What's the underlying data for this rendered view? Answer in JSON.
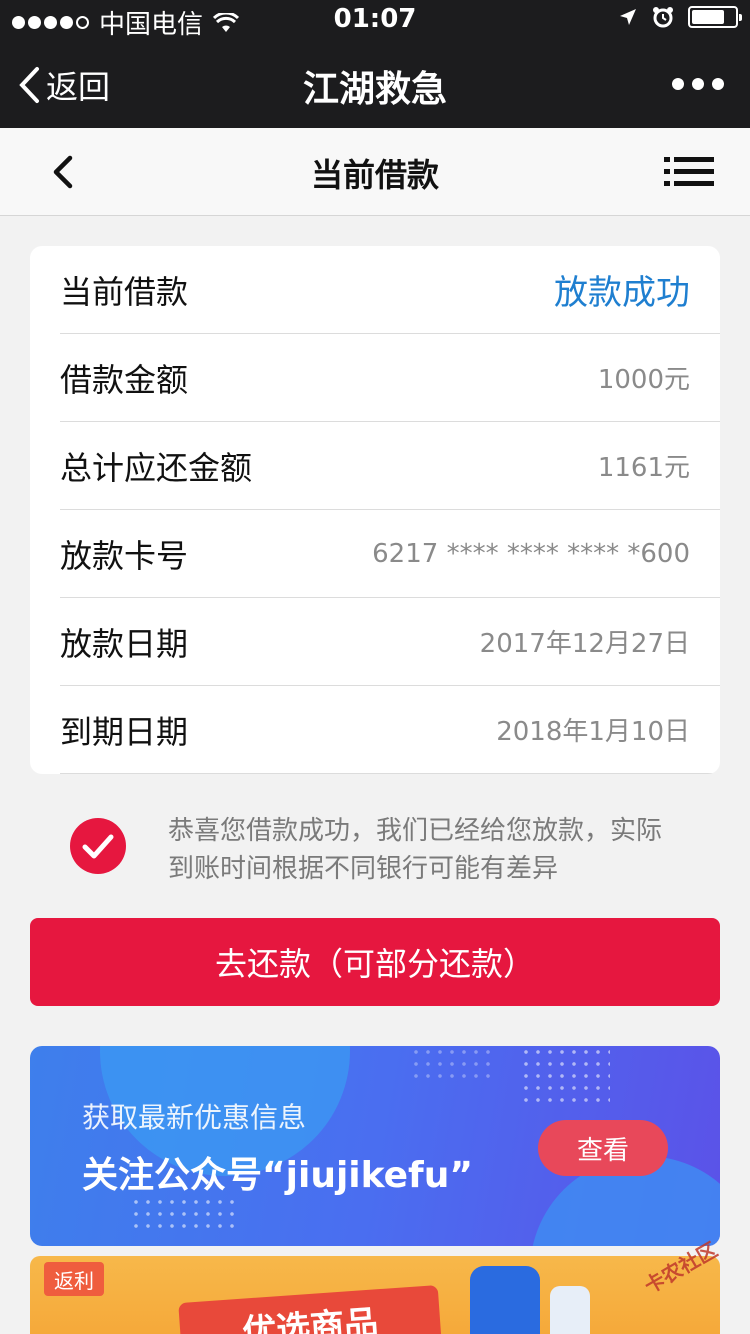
{
  "status_bar": {
    "carrier": "中国电信",
    "time": "01:07"
  },
  "nav_bar": {
    "back_label": "返回",
    "title": "江湖救急"
  },
  "page_header": {
    "title": "当前借款"
  },
  "loan_card": {
    "rows": [
      {
        "label": "当前借款",
        "value": "放款成功"
      },
      {
        "label": "借款金额",
        "value": "1000元"
      },
      {
        "label": "总计应还金额",
        "value": "1161元"
      },
      {
        "label": "放款卡号",
        "value": "6217 **** **** **** *600"
      },
      {
        "label": "放款日期",
        "value": "2017年12月27日"
      },
      {
        "label": "到期日期",
        "value": "2018年1月10日"
      }
    ]
  },
  "notice": {
    "line1": "恭喜您借款成功，我们已经给您放款，实际",
    "line2": "到账时间根据不同银行可能有差异"
  },
  "repay_button": {
    "label": "去还款（可部分还款）"
  },
  "promo_banner": {
    "subtitle": "获取最新优惠信息",
    "title": "关注公众号“jiujikefu”",
    "button": "查看"
  },
  "product_banner": {
    "logo_text": "返利",
    "tag_text": "优选商品"
  },
  "watermark": {
    "text": "卡农社区"
  },
  "colors": {
    "accent_red": "#e6173f",
    "status_blue": "#1f7fd0",
    "banner_blue": "#4a6ef0"
  },
  "battery_level": 0.75
}
